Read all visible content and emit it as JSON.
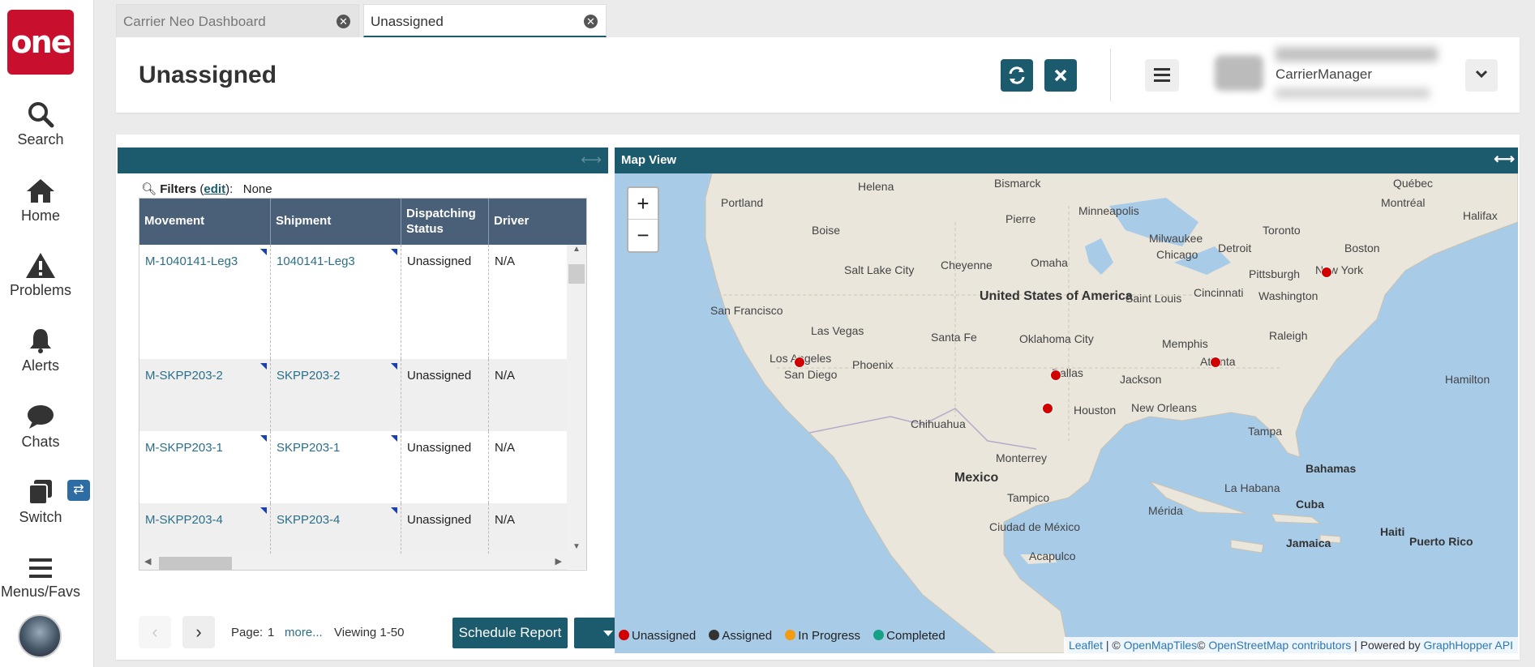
{
  "sidebar": {
    "logo": "one",
    "items": [
      {
        "label": "Search",
        "icon": "search-icon"
      },
      {
        "label": "Home",
        "icon": "home-icon"
      },
      {
        "label": "Problems",
        "icon": "warning-icon"
      },
      {
        "label": "Alerts",
        "icon": "bell-icon"
      },
      {
        "label": "Chats",
        "icon": "chat-icon"
      },
      {
        "label": "Switch",
        "icon": "switch-icon"
      },
      {
        "label": "Menus/Favs",
        "icon": "hamburger-icon"
      }
    ],
    "switch_badge": "⇄"
  },
  "tabs": [
    {
      "label": "Carrier Neo Dashboard"
    },
    {
      "label": "Unassigned"
    }
  ],
  "header": {
    "title": "Unassigned",
    "user_role": "CarrierManager"
  },
  "filters": {
    "label": "Filters",
    "edit": "edit",
    "value": "None"
  },
  "grid": {
    "columns": [
      "Movement",
      "Shipment",
      "Dispatching Status",
      "Driver"
    ],
    "rows": [
      {
        "movement": "M-1040141-Leg3",
        "shipment": "1040141-Leg3",
        "status": "Unassigned",
        "driver": "N/A"
      },
      {
        "movement": "M-SKPP203-2",
        "shipment": "SKPP203-2",
        "status": "Unassigned",
        "driver": "N/A"
      },
      {
        "movement": "M-SKPP203-1",
        "shipment": "SKPP203-1",
        "status": "Unassigned",
        "driver": "N/A"
      },
      {
        "movement": "M-SKPP203-4",
        "shipment": "SKPP203-4",
        "status": "Unassigned",
        "driver": "N/A"
      }
    ]
  },
  "pager": {
    "page_label": "Page:",
    "page": "1",
    "more": "more...",
    "viewing": "Viewing 1-50",
    "schedule_report": "Schedule Report"
  },
  "map": {
    "title": "Map View",
    "zoom_in": "+",
    "zoom_out": "−",
    "cities": [
      "Helena",
      "Bismarck",
      "Québec",
      "Portland",
      "Montréal",
      "Minneapolis",
      "Halifax",
      "Boise",
      "Pierre",
      "Milwaukee",
      "Toronto",
      "Detroit",
      "Boston",
      "Chicago",
      "Salt Lake City",
      "Cheyenne",
      "Omaha",
      "Pittsburgh",
      "New York",
      "United States of America",
      "Cincinnati",
      "Washington",
      "Saint Louis",
      "San Francisco",
      "Las Vegas",
      "Santa Fe",
      "Oklahoma City",
      "Memphis",
      "Raleigh",
      "Los Angeles",
      "Phoenix",
      "Atlanta",
      "San Diego",
      "Dallas",
      "Jackson",
      "Hamilton",
      "Houston",
      "New Orleans",
      "Chihuahua",
      "Tampa",
      "Monterrey",
      "Bahamas",
      "Mexico",
      "La Habana",
      "Tampico",
      "Cuba",
      "Mérida",
      "Ciudad de México",
      "Haiti",
      "Jamaica",
      "Puerto Rico",
      "Acapulco"
    ],
    "legend": [
      {
        "label": "Unassigned",
        "color": "#d00000"
      },
      {
        "label": "Assigned",
        "color": "#333333"
      },
      {
        "label": "In Progress",
        "color": "#f39c12"
      },
      {
        "label": "Completed",
        "color": "#16a085"
      }
    ],
    "attribution": {
      "leaflet": "Leaflet",
      "sep1": " | © ",
      "omt": "OpenMapTiles",
      "sep2": "© ",
      "osm": "OpenStreetMap contributors",
      "sep3": " | Powered by ",
      "gh": "GraphHopper API"
    }
  }
}
